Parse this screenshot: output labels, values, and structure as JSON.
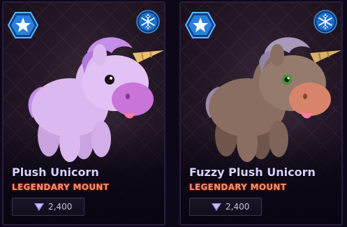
{
  "colors": {
    "name_text": "#d9d2ff",
    "rarity_text": "#ff8e6a",
    "rarity_badge": "#2a7fd9",
    "freeze_badge": "#1a6fcf",
    "currency_gem": "#9e8ce8"
  },
  "icons": {
    "rarity": "star-hexagon-icon",
    "freeze": "snowflake-icon",
    "currency": "gem-icon"
  },
  "cards": [
    {
      "name": "Plush Unicorn",
      "rarity": "LEGENDARY MOUNT",
      "price": "2,400",
      "body_color": "#dcb8f0",
      "mane_color": "#c58ee8",
      "muzzle_color": "#c974d8",
      "eye_color": "#1a1018"
    },
    {
      "name": "Fuzzy Plush Unicorn",
      "rarity": "LEGENDARY MOUNT",
      "price": "2,400",
      "body_color": "#8a6e62",
      "mane_color": "#a89ab8",
      "muzzle_color": "#d8846a",
      "eye_color": "#3a9a2a"
    }
  ]
}
